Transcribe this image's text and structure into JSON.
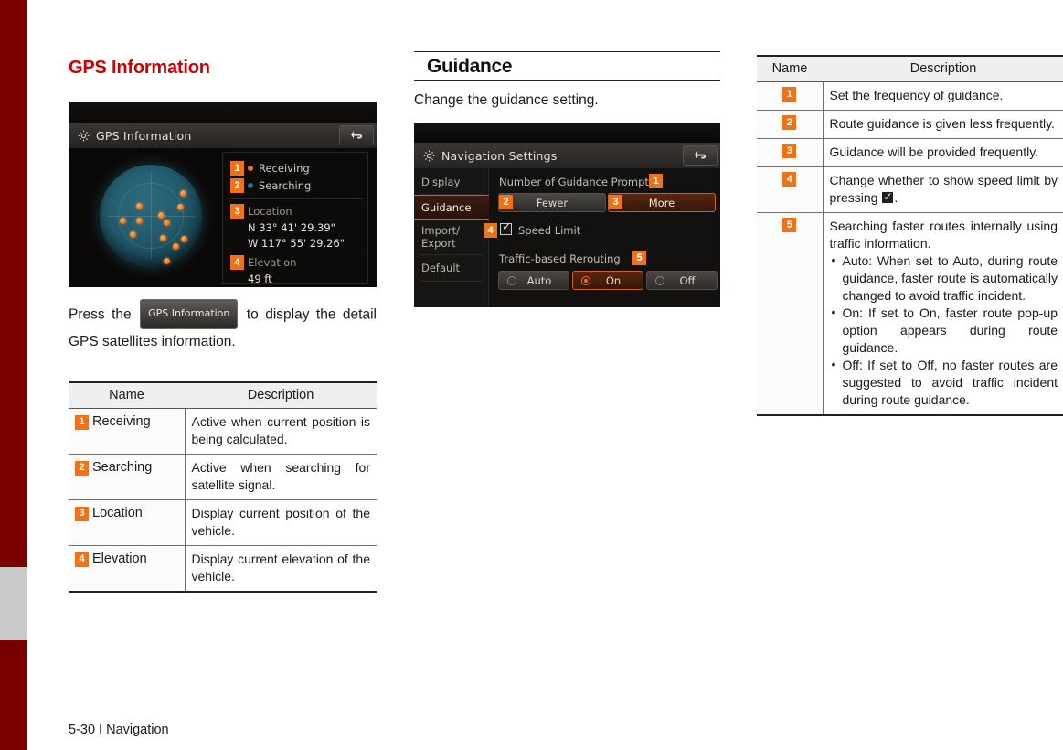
{
  "page": {
    "footer": "5-30 I Navigation",
    "accent_red": "#cc0000",
    "accent_orange": "#ee7219",
    "edge_maroon": "#7a0000",
    "edge_gray": "#c9cacc"
  },
  "left_column": {
    "heading": "GPS Information",
    "device": {
      "title": "GPS Information",
      "gear_icon": "gear-icon",
      "back_icon": "back-arrow-icon",
      "legend": [
        {
          "badge": "1",
          "label": "Receiving",
          "dot_color": "#e8731a"
        },
        {
          "badge": "2",
          "label": "Searching",
          "dot_color": "#2f7385"
        }
      ],
      "location": {
        "badge": "3",
        "label": "Location",
        "lat": "N 33° 41' 29.39\"",
        "lon": "W 117° 55' 29.26\""
      },
      "elevation": {
        "badge": "4",
        "label": "Elevation",
        "value": "49 ft"
      }
    },
    "paragraph_before": "Press the",
    "inline_button": "GPS Information",
    "paragraph_after": "to display the detail GPS satellites information.",
    "table": {
      "headers": [
        "Name",
        "Description"
      ],
      "rows": [
        {
          "badge": "1",
          "name": "Receiving",
          "desc": "Active when current position is being calculated."
        },
        {
          "badge": "2",
          "name": "Searching",
          "desc": "Active when searching for satellite signal."
        },
        {
          "badge": "3",
          "name": "Location",
          "desc": "Display current position of the vehicle."
        },
        {
          "badge": "4",
          "name": "Elevation",
          "desc": "Display current elevation of the vehicle."
        }
      ]
    }
  },
  "mid_column": {
    "heading": "Guidance",
    "intro": "Change the guidance setting.",
    "device": {
      "title": "Navigation Settings",
      "gear_icon": "gear-icon",
      "back_icon": "back-arrow-icon",
      "side_menu": [
        {
          "label": "Display",
          "active": false
        },
        {
          "label": "Guidance",
          "active": true
        },
        {
          "label": "Import/\nExport",
          "active": false
        },
        {
          "label": "Default",
          "active": false
        }
      ],
      "side_menu_labels": {
        "display": "Display",
        "guidance": "Guidance",
        "import_export_line1": "Import/",
        "import_export_line2": "Export",
        "default": "Default"
      },
      "prompts_label": "Number of Guidance Prompts",
      "prompts_badge": "1",
      "fewer_badge": "2",
      "fewer_label": "Fewer",
      "more_badge": "3",
      "more_label": "More",
      "speed_limit_badge": "4",
      "speed_limit_label": "Speed Limit",
      "speed_limit_checked": true,
      "rerouting_label": "Traffic-based Rerouting",
      "rerouting_badge": "5",
      "rerouting_options": [
        {
          "label": "Auto",
          "selected": false
        },
        {
          "label": "On",
          "selected": true
        },
        {
          "label": "Off",
          "selected": false
        }
      ],
      "rerouting_option_labels": {
        "auto": "Auto",
        "on": "On",
        "off": "Off"
      }
    }
  },
  "right_column": {
    "table": {
      "headers": [
        "Name",
        "Description"
      ],
      "rows": [
        {
          "badge": "1",
          "desc": "Set the frequency of guidance."
        },
        {
          "badge": "2",
          "desc": "Route guidance is given less frequently."
        },
        {
          "badge": "3",
          "desc": "Guidance will be provided frequently."
        },
        {
          "badge": "4",
          "desc_before": "Change whether to show speed limit by pressing",
          "desc_after": "."
        },
        {
          "badge": "5",
          "intro": "Searching faster routes internally using traffic information.",
          "bullets": [
            "Auto: When set to Auto, during route guidance, faster route is automatically changed to avoid traffic incident.",
            "On: If set to On, faster route pop-up option appears during route guidance.",
            "Off: If set to Off, no faster routes are suggested to avoid traffic incident during route guidance."
          ]
        }
      ]
    }
  }
}
